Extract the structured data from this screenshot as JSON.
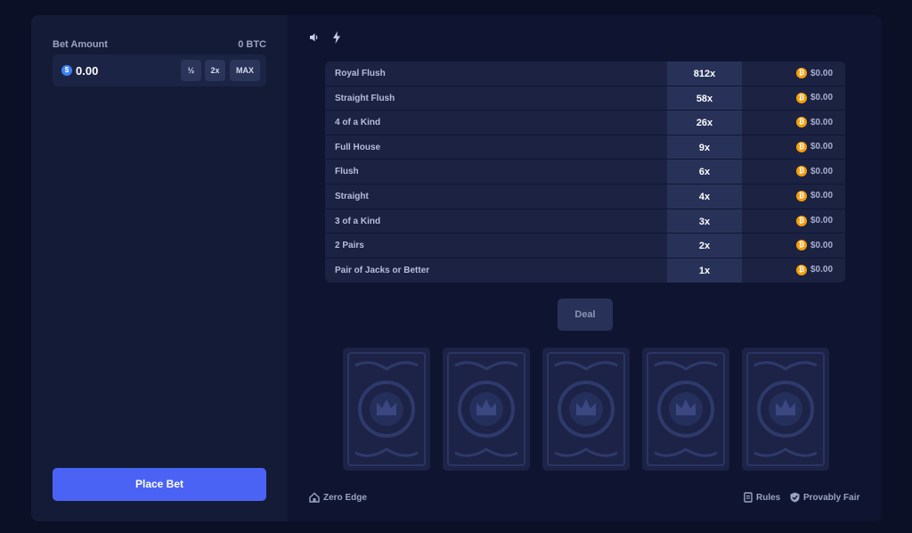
{
  "sidebar": {
    "bet_label": "Bet Amount",
    "bet_currency_amount": "0 BTC",
    "bet_value": "0.00",
    "half_label": "½",
    "double_label": "2x",
    "max_label": "MAX",
    "place_bet_label": "Place Bet"
  },
  "paytable": [
    {
      "hand": "Royal Flush",
      "multiplier": "812x",
      "payout": "$0.00"
    },
    {
      "hand": "Straight Flush",
      "multiplier": "58x",
      "payout": "$0.00"
    },
    {
      "hand": "4 of a Kind",
      "multiplier": "26x",
      "payout": "$0.00"
    },
    {
      "hand": "Full House",
      "multiplier": "9x",
      "payout": "$0.00"
    },
    {
      "hand": "Flush",
      "multiplier": "6x",
      "payout": "$0.00"
    },
    {
      "hand": "Straight",
      "multiplier": "4x",
      "payout": "$0.00"
    },
    {
      "hand": "3 of a Kind",
      "multiplier": "3x",
      "payout": "$0.00"
    },
    {
      "hand": "2 Pairs",
      "multiplier": "2x",
      "payout": "$0.00"
    },
    {
      "hand": "Pair of Jacks or Better",
      "multiplier": "1x",
      "payout": "$0.00"
    }
  ],
  "game": {
    "deal_label": "Deal"
  },
  "footer": {
    "zero_edge_label": "Zero Edge",
    "rules_label": "Rules",
    "provably_fair_label": "Provably Fair"
  },
  "colors": {
    "accent": "#4b63f5",
    "coin": "#f59e0b",
    "usd_coin": "#3b82f6"
  }
}
